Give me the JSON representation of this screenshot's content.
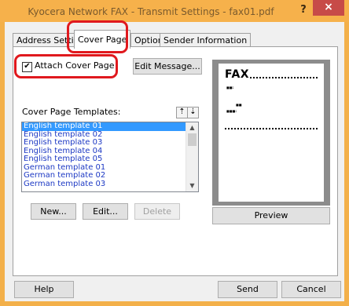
{
  "window": {
    "title": "Kyocera Network FAX - Transmit Settings - fax01.pdf",
    "help_label": "?",
    "close_label": "×"
  },
  "tabs": [
    {
      "label": "Address Setting"
    },
    {
      "label": "Cover Page"
    },
    {
      "label": "Option"
    },
    {
      "label": "Sender Information"
    }
  ],
  "cover_page": {
    "attach_checked": true,
    "attach_label": "Attach Cover Page",
    "edit_message_label": "Edit Message...",
    "templates_label": "Cover Page Templates:",
    "up_label": "⇡",
    "down_label": "⇣",
    "templates": [
      "English template 01",
      "English template 02",
      "English template 03",
      "English template 04",
      "English template 05",
      "German template 01",
      "German template 02",
      "German template 03"
    ],
    "selected_template": "English template 01",
    "new_label": "New...",
    "edit_label": "Edit...",
    "delete_label": "Delete",
    "preview_label": "Preview",
    "preview_title": "FAX",
    "preview_field_1": "■■:",
    "preview_field_2": "■■",
    "preview_field_3": "■■■:"
  },
  "footer": {
    "help_label": "Help",
    "send_label": "Send",
    "cancel_label": "Cancel"
  },
  "colors": {
    "title_bar": "#f6b14b",
    "close_button": "#c74b48",
    "highlight": "#e0191e",
    "selection": "#3399ff",
    "list_text": "#1d39c4"
  }
}
